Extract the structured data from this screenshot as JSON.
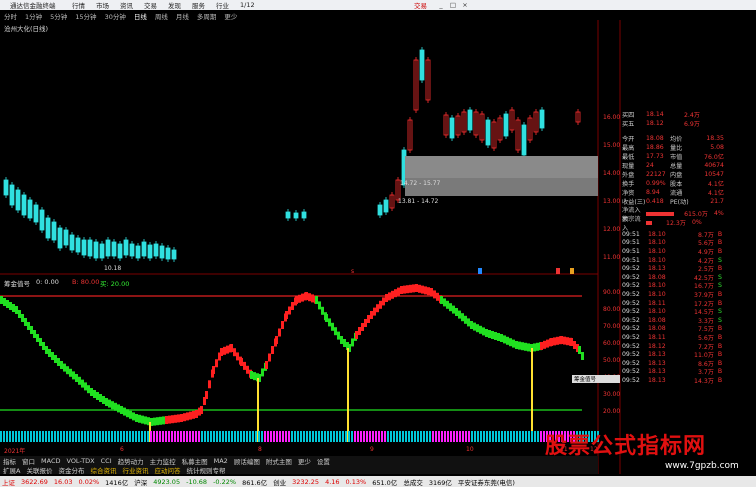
{
  "menubar": {
    "app_title": "通达信金融终端",
    "items": [
      "行情",
      "市场",
      "资讯",
      "交易",
      "发现",
      "服务",
      "行业",
      "1/12"
    ],
    "window_title": "交易",
    "window_controls": [
      "_",
      "□",
      "×"
    ]
  },
  "periods": [
    "分时",
    "1分钟",
    "5分钟",
    "15分钟",
    "30分钟",
    "日线",
    "周线",
    "月线",
    "多周期",
    "更少"
  ],
  "active_period": "日线",
  "stock_name": "沧州大化(日线)",
  "price_labels": {
    "high": "14.72 - 15.77",
    "mid": "13.81 - 14.72",
    "low": "10.18"
  },
  "price_axis": [
    "16.00",
    "15.00",
    "14.00",
    "13.00",
    "12.00",
    "11.00"
  ],
  "indicator": {
    "name": "筹金值号",
    "value": "0: 0.00",
    "labels": [
      "B: 80.00",
      "买: 20.00"
    ],
    "axis": [
      "90.00",
      "80.00",
      "70.00",
      "60.00",
      "50.00",
      "40.00",
      "30.00",
      "20.00"
    ]
  },
  "popup_label": "筹金值号",
  "date_marks": [
    "2021年",
    "6",
    "8",
    "9",
    "10",
    "11",
    "12"
  ],
  "quote": {
    "book": [
      {
        "l": "买四",
        "v": "18.14",
        "v2": "2.4万"
      },
      {
        "l": "买五",
        "v": "18.12",
        "v2": "6.9万"
      }
    ],
    "stats": [
      {
        "l": "今开",
        "v": "18.08",
        "l2": "均价",
        "v2": "18.35"
      },
      {
        "l": "最高",
        "v": "18.86",
        "l2": "量比",
        "v2": "5.08"
      },
      {
        "l": "最低",
        "v": "17.73",
        "l2": "市值",
        "v2": "76.0亿"
      },
      {
        "l": "现量",
        "v": "24",
        "l2": "总量",
        "v2": "40674"
      },
      {
        "l": "外盘",
        "v": "22127",
        "l2": "内盘",
        "v2": "10547"
      },
      {
        "l": "换手",
        "v": "0.99%",
        "l2": "股本",
        "v2": "4.1亿"
      },
      {
        "l": "净资",
        "v": "8.94",
        "l2": "流通",
        "v2": "4.1亿"
      },
      {
        "l": "收益(三)",
        "v": "0.418",
        "l2": "PE(动)",
        "v2": "21.7"
      }
    ],
    "flows": [
      {
        "l": "净流入额",
        "v": "615.0万",
        "pct": "4%"
      },
      {
        "l": "大宗流入",
        "v": "12.3万",
        "pct": "0%"
      }
    ]
  },
  "ticks": [
    {
      "t": "09:51",
      "p": "18.10",
      "v": "8.7万",
      "bs": "B"
    },
    {
      "t": "09:51",
      "p": "18.10",
      "v": "5.6万",
      "bs": "B"
    },
    {
      "t": "09:51",
      "p": "18.10",
      "v": "4.9万",
      "bs": "B"
    },
    {
      "t": "09:51",
      "p": "18.10",
      "v": "4.2万",
      "bs": "S"
    },
    {
      "t": "09:52",
      "p": "18.13",
      "v": "2.5万",
      "bs": "B"
    },
    {
      "t": "09:52",
      "p": "18.08",
      "v": "42.5万",
      "bs": "S"
    },
    {
      "t": "09:52",
      "p": "18.10",
      "v": "16.7万",
      "bs": "S"
    },
    {
      "t": "09:52",
      "p": "18.10",
      "v": "37.9万",
      "bs": "B"
    },
    {
      "t": "09:52",
      "p": "18.11",
      "v": "17.2万",
      "bs": "B"
    },
    {
      "t": "09:52",
      "p": "18.10",
      "v": "14.5万",
      "bs": "S"
    },
    {
      "t": "09:52",
      "p": "18.08",
      "v": "3.3万",
      "bs": "S"
    },
    {
      "t": "09:52",
      "p": "18.08",
      "v": "7.5万",
      "bs": "B"
    },
    {
      "t": "09:52",
      "p": "18.11",
      "v": "5.6万",
      "bs": "B"
    },
    {
      "t": "09:52",
      "p": "18.12",
      "v": "7.2万",
      "bs": "B"
    },
    {
      "t": "09:52",
      "p": "18.13",
      "v": "11.0万",
      "bs": "B"
    },
    {
      "t": "09:52",
      "p": "18.13",
      "v": "8.6万",
      "bs": "B"
    },
    {
      "t": "09:52",
      "p": "18.13",
      "v": "3.7万",
      "bs": "B"
    },
    {
      "t": "09:52",
      "p": "18.13",
      "v": "14.3万",
      "bs": "B"
    }
  ],
  "tabs": [
    "指标",
    "窗口",
    "MACD",
    "VOL-TDX",
    "CCI",
    "趋势动力",
    "主力监控",
    "私募主图",
    "MA2",
    "顾话编图",
    "附式主图",
    "更少",
    "设置"
  ],
  "tabs2": [
    "扩展A",
    "关联报价",
    "资金分布",
    "综合资讯",
    "行业资讯",
    "应动问答",
    "统计规则专帮"
  ],
  "status": {
    "sh_label": "上证",
    "sh_val": "3622.69",
    "sh_chg": "16.03",
    "sh_pct": "0.02%",
    "sh_amt": "1416亿",
    "hs_label": "沪深",
    "hs_val": "4923.05",
    "hs_chg": "-10.68",
    "hs_pct": "-0.22%",
    "hs_amt": "861.6亿",
    "cy_label": "创业",
    "cy_val": "3232.25",
    "cy_chg": "4.16",
    "cy_pct": "0.13%",
    "cy_amt": "651.0亿",
    "total_label": "总成交",
    "total": "3169亿",
    "broker": "平安证券东莞(电信)"
  },
  "watermark": "股票公式指标网",
  "watermark_url": "www.7gpzb.com",
  "colors": {
    "up": "#ff2020",
    "down": "#20e020",
    "bg": "#000000",
    "accent": "#e6c200"
  }
}
